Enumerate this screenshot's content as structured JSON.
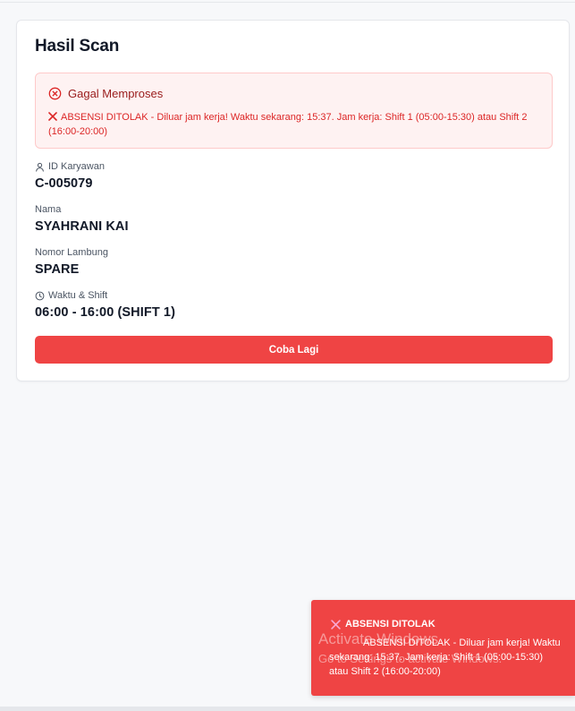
{
  "card": {
    "title": "Hasil Scan",
    "alert": {
      "title": "Gagal Memproses",
      "message": "ABSENSI DITOLAK - Diluar jam kerja! Waktu sekarang: 15:37. Jam kerja: Shift 1 (05:00-15:30) atau Shift 2 (16:00-20:00)"
    },
    "fields": {
      "id": {
        "label": "ID Karyawan",
        "value": "C-005079"
      },
      "name": {
        "label": "Nama",
        "value": "SYAHRANI KAI"
      },
      "hull": {
        "label": "Nomor Lambung",
        "value": "SPARE"
      },
      "shift": {
        "label": "Waktu & Shift",
        "value": "06:00 - 16:00 (SHIFT 1)"
      }
    },
    "retry_label": "Coba Lagi"
  },
  "toast": {
    "title": "ABSENSI DITOLAK",
    "message": "ABSENSI DITOLAK - Diluar jam kerja! Waktu sekarang: 15:37. Jam kerja: Shift 1 (05:00-15:30) atau Shift 2 (16:00-20:00)"
  },
  "watermark": {
    "line1": "Activate Windows",
    "line2": "Go to Settings to activate Windows."
  },
  "colors": {
    "danger": "#ef4444",
    "alert_bg": "#fef2f2",
    "alert_title": "#991b1b",
    "alert_text": "#dc2626"
  },
  "icons": {
    "alert": "x-circle-icon",
    "message": "x-mark-icon",
    "id_field": "user-icon",
    "shift_field": "clock-icon",
    "toast": "x-mark-icon"
  }
}
